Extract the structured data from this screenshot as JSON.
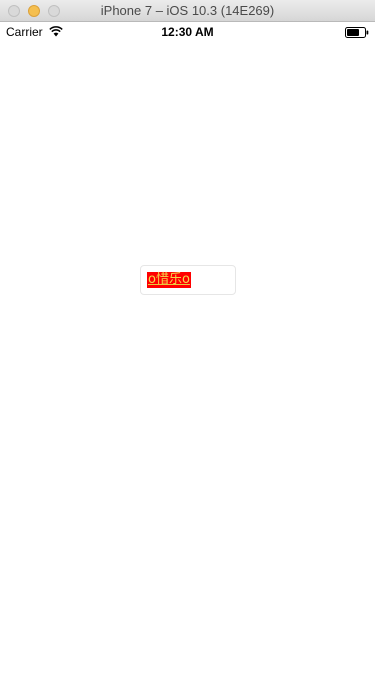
{
  "window": {
    "title": "iPhone 7 – iOS 10.3 (14E269)"
  },
  "status_bar": {
    "carrier": "Carrier",
    "time": "12:30 AM",
    "icons": [
      "wifi-icon",
      "battery-icon"
    ]
  },
  "content": {
    "text_box": {
      "text": "o惜乐o"
    }
  },
  "colors": {
    "highlight_background": "#ff0000",
    "highlight_text": "#f2d84c",
    "window_minimize": "#f5bf4f"
  }
}
